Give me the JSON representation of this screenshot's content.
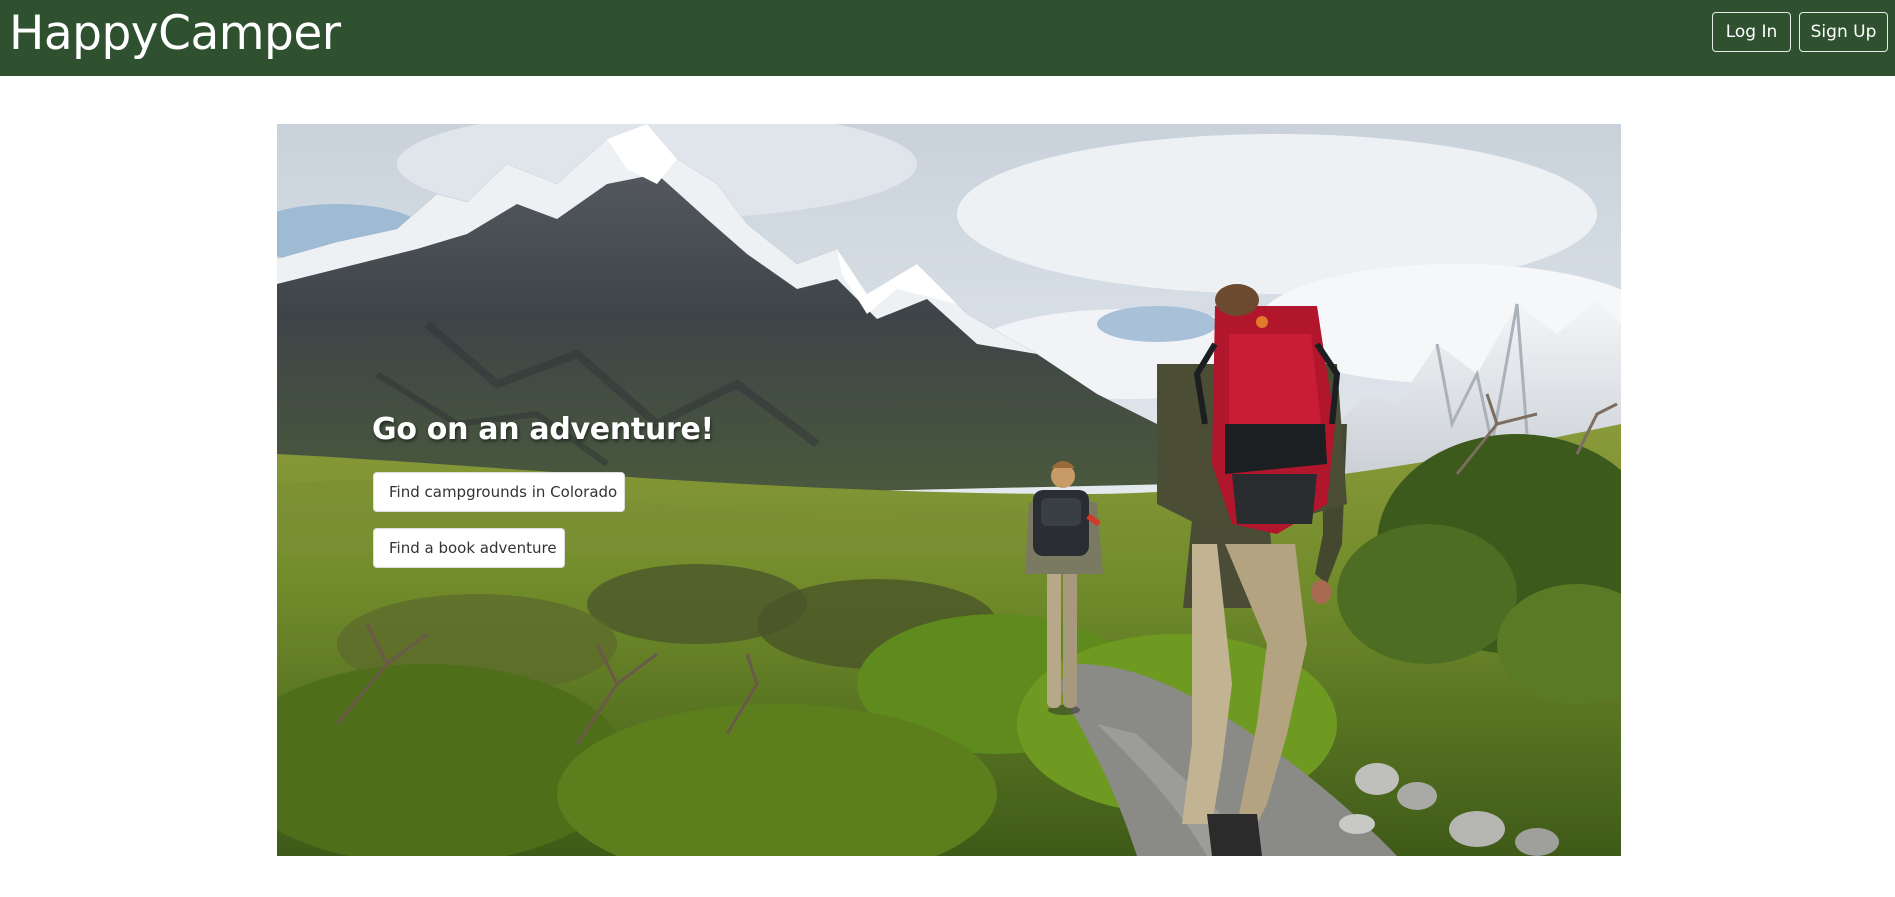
{
  "navbar": {
    "brand": "HappyCamper",
    "login_label": "Log In",
    "signup_label": "Sign Up",
    "background_color": "#2f5130"
  },
  "hero": {
    "image": "mountain-hikers-photo",
    "title": "Go on an adventure!",
    "buttons": [
      {
        "label": "Find campgrounds in Colorado"
      },
      {
        "label": "Find a book adventure"
      }
    ]
  }
}
